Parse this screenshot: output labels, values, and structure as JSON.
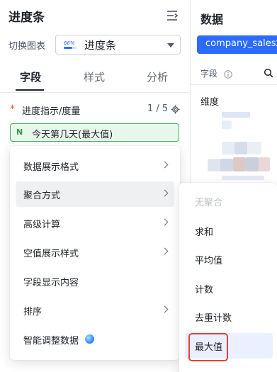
{
  "panel": {
    "title": "进度条",
    "switch_label": "切换图表",
    "chart_type": "进度条",
    "chart_type_icon_text": "66%"
  },
  "tabs": [
    {
      "label": "字段",
      "active": true
    },
    {
      "label": "样式",
      "active": false
    },
    {
      "label": "分析",
      "active": false
    }
  ],
  "field_section": {
    "title": "进度指示/度量",
    "count": "1 / 5",
    "chip": {
      "icon_text": "N",
      "label": "今天第几天(最大值)"
    }
  },
  "context_menu": {
    "items": [
      {
        "label": "数据展示格式",
        "has_submenu": true
      },
      {
        "label": "聚合方式",
        "has_submenu": true,
        "hover": true
      },
      {
        "label": "高级计算",
        "has_submenu": true
      },
      {
        "label": "空值展示样式",
        "has_submenu": true
      },
      {
        "label": "字段显示内容",
        "has_submenu": false
      },
      {
        "label": "排序",
        "has_submenu": true
      },
      {
        "label": "智能调整数据",
        "has_submenu": false,
        "icon": "ai-sparkle-icon"
      }
    ]
  },
  "aggregation_submenu": {
    "items": [
      {
        "label": "无聚合",
        "disabled": true
      },
      {
        "label": "求和"
      },
      {
        "label": "平均值"
      },
      {
        "label": "计数"
      },
      {
        "label": "去重计数"
      },
      {
        "label": "最大值",
        "selected": true
      }
    ]
  },
  "data_panel": {
    "title": "数据",
    "dataset": "company_salesz",
    "field_label": "字段",
    "dimension_label": "维度"
  },
  "colors": {
    "accent": "#2b6bff",
    "chip_green": "#3eb65a",
    "highlight_red": "#e0433a",
    "required_red": "#f54a45"
  }
}
